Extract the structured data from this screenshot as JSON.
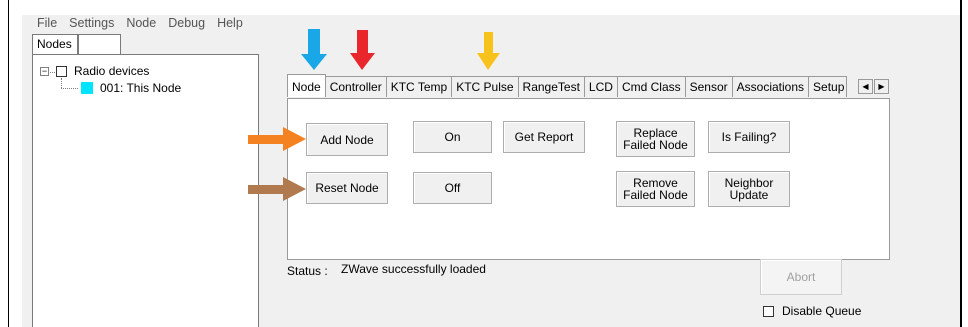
{
  "menu": [
    "File",
    "Settings",
    "Node",
    "Debug",
    "Help"
  ],
  "outer_tabs": [
    "Nodes",
    ""
  ],
  "tree": {
    "root_label": "Radio devices",
    "node_label": "001: This Node",
    "node_color": "#00e5ff",
    "expander": "−"
  },
  "node_tabs": [
    "Node",
    "Controller",
    "KTC Temp",
    "KTC Pulse",
    "RangeTest",
    "LCD",
    "Cmd Class",
    "Sensor",
    "Associations",
    "Setup"
  ],
  "scroll": {
    "left": "◀",
    "right": "▶"
  },
  "buttons": {
    "add_node": "Add Node",
    "reset_node": "Reset Node",
    "on": "On",
    "off": "Off",
    "get_report": "Get Report",
    "replace_failed_1": "Replace",
    "replace_failed_2": "Failed Node",
    "remove_failed_1": "Remove",
    "remove_failed_2": "Failed Node",
    "is_failing": "Is Failing?",
    "neighbor_update_1": "Neighbor",
    "neighbor_update_2": "Update",
    "abort": "Abort"
  },
  "status": {
    "label": "Status :",
    "text": "ZWave successfully loaded"
  },
  "disable_queue": "Disable Queue",
  "annotation_colors": {
    "blue": "#1aa7e8",
    "red": "#e8262b",
    "yellow": "#f8c21c",
    "orange": "#f58220",
    "brown": "#b07a4e"
  }
}
